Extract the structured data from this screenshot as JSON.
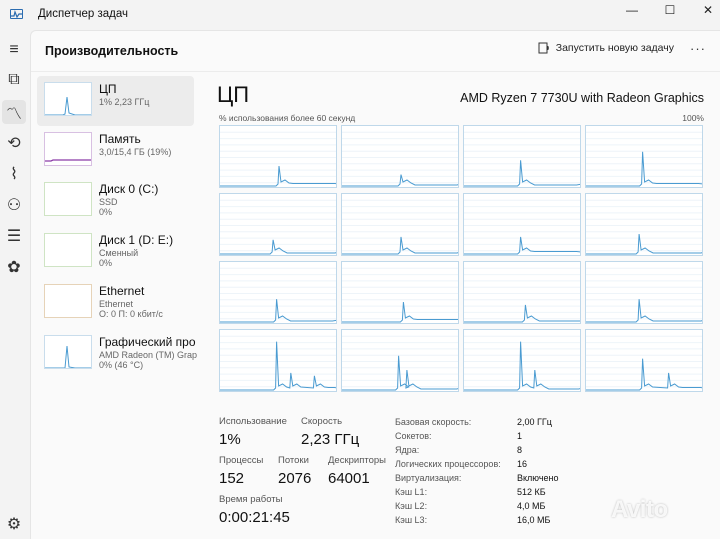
{
  "window": {
    "title": "Диспетчер задач",
    "min_glyph": "—",
    "max_glyph": "☐",
    "close_glyph": "✕"
  },
  "rail": {
    "items": [
      {
        "name": "menu-icon",
        "glyph": "≡"
      },
      {
        "name": "processes-icon",
        "glyph": "⧉"
      },
      {
        "name": "performance-icon",
        "glyph": "〽",
        "active": true
      },
      {
        "name": "app-history-icon",
        "glyph": "⟲"
      },
      {
        "name": "startup-icon",
        "glyph": "⌇"
      },
      {
        "name": "users-icon",
        "glyph": "⚇"
      },
      {
        "name": "details-icon",
        "glyph": "☰"
      },
      {
        "name": "services-icon",
        "glyph": "✿"
      }
    ],
    "settings_glyph": "⚙"
  },
  "header": {
    "title": "Производительность",
    "run_task": "Запустить новую задачу",
    "more": "···"
  },
  "devices": [
    {
      "name": "ЦП",
      "sub1": "1% 2,23 ГГц",
      "sub2": "",
      "active": true
    },
    {
      "name": "Память",
      "sub1": "3,0/15,4 ГБ (19%)",
      "sub2": ""
    },
    {
      "name": "Диск 0 (C:)",
      "sub1": "SSD",
      "sub2": "0%"
    },
    {
      "name": "Диск 1 (D: E:)",
      "sub1": "Сменный",
      "sub2": "0%"
    },
    {
      "name": "Ethernet",
      "sub1": "Ethernet",
      "sub2": "О: 0 П: 0 кбит/с"
    },
    {
      "name": "Графический про",
      "sub1": "AMD Radeon (TM) Grap",
      "sub2": "0% (46 °C)"
    }
  ],
  "cpu": {
    "title": "ЦП",
    "model": "AMD Ryzen 7 7730U with Radeon Graphics",
    "graph_label": "% использования более 60 секунд",
    "graph_max": "100%"
  },
  "stats": {
    "usage_label": "Использование",
    "usage_value": "1%",
    "speed_label": "Скорость",
    "speed_value": "2,23 ГГц",
    "processes_label": "Процессы",
    "processes_value": "152",
    "threads_label": "Потоки",
    "threads_value": "2076",
    "handles_label": "Дескрипторы",
    "handles_value": "64001",
    "uptime_label": "Время работы",
    "uptime_value": "0:00:21:45"
  },
  "specs": [
    {
      "k": "Базовая скорость:",
      "v": "2,00 ГГц"
    },
    {
      "k": "Сокетов:",
      "v": "1"
    },
    {
      "k": "Ядра:",
      "v": "8"
    },
    {
      "k": "Логических процессоров:",
      "v": "16"
    },
    {
      "k": "Виртуализация:",
      "v": "Включено"
    },
    {
      "k": "Кэш L1:",
      "v": "512 КБ"
    },
    {
      "k": "Кэш L2:",
      "v": "4,0 МБ"
    },
    {
      "k": "Кэш L3:",
      "v": "16,0 МБ"
    }
  ],
  "colors": {
    "graph_line": "#4a9bd1",
    "graph_border": "#bfd8ea",
    "memory_line": "#8b3aa8"
  },
  "watermark": "Avito"
}
